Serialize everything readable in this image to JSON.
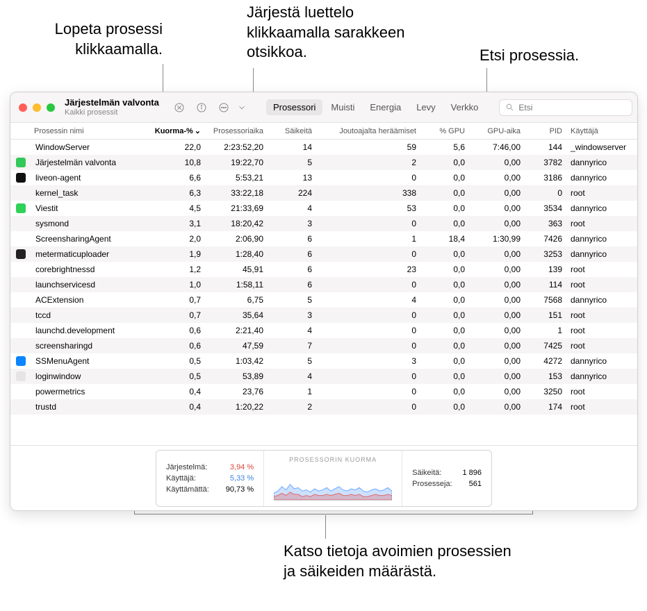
{
  "callouts": {
    "stop": "Lopeta prosessi klikkaamalla.",
    "sort": "Järjestä luettelo klikkaamalla sarakkeen otsikkoa.",
    "search": "Etsi prosessia.",
    "footer": "Katso tietoja avoimien prosessien ja säikeiden määrästä."
  },
  "window": {
    "title": "Järjestelmän valvonta",
    "subtitle": "Kaikki prosessit"
  },
  "tabs": {
    "cpu": "Prosessori",
    "memory": "Muisti",
    "energy": "Energia",
    "disk": "Levy",
    "network": "Verkko"
  },
  "search": {
    "placeholder": "Etsi"
  },
  "columns": {
    "name": "Prosessin nimi",
    "cpu": "Kuorma-%",
    "cputime": "Prosessoriaika",
    "threads": "Säikeitä",
    "idlewake": "Joutoajalta heräämiset",
    "gpu": "% GPU",
    "gputime": "GPU-aika",
    "pid": "PID",
    "user": "Käyttäjä"
  },
  "rows": [
    {
      "icon": "",
      "name": "WindowServer",
      "cpu": "22,0",
      "cputime": "2:23:52,20",
      "threads": "14",
      "idle": "59",
      "gpu": "5,6",
      "gputime": "7:46,00",
      "pid": "144",
      "user": "_windowserver"
    },
    {
      "icon": "#34c759",
      "name": "Järjestelmän valvonta",
      "cpu": "10,8",
      "cputime": "19:22,70",
      "threads": "5",
      "idle": "2",
      "gpu": "0,0",
      "gputime": "0,00",
      "pid": "3782",
      "user": "dannyrico"
    },
    {
      "icon": "#111",
      "name": "liveon-agent",
      "cpu": "6,6",
      "cputime": "5:53,21",
      "threads": "13",
      "idle": "0",
      "gpu": "0,0",
      "gputime": "0,00",
      "pid": "3186",
      "user": "dannyrico"
    },
    {
      "icon": "",
      "name": "kernel_task",
      "cpu": "6,3",
      "cputime": "33:22,18",
      "threads": "224",
      "idle": "338",
      "gpu": "0,0",
      "gputime": "0,00",
      "pid": "0",
      "user": "root"
    },
    {
      "icon": "#30d158",
      "name": "Viestit",
      "cpu": "4,5",
      "cputime": "21:33,69",
      "threads": "4",
      "idle": "53",
      "gpu": "0,0",
      "gputime": "0,00",
      "pid": "3534",
      "user": "dannyrico"
    },
    {
      "icon": "",
      "name": "sysmond",
      "cpu": "3,1",
      "cputime": "18:20,42",
      "threads": "3",
      "idle": "0",
      "gpu": "0,0",
      "gputime": "0,00",
      "pid": "363",
      "user": "root"
    },
    {
      "icon": "",
      "name": "ScreensharingAgent",
      "cpu": "2,0",
      "cputime": "2:06,90",
      "threads": "6",
      "idle": "1",
      "gpu": "18,4",
      "gputime": "1:30,99",
      "pid": "7426",
      "user": "dannyrico"
    },
    {
      "icon": "#222",
      "name": "metermaticuploader",
      "cpu": "1,9",
      "cputime": "1:28,40",
      "threads": "6",
      "idle": "0",
      "gpu": "0,0",
      "gputime": "0,00",
      "pid": "3253",
      "user": "dannyrico"
    },
    {
      "icon": "",
      "name": "corebrightnessd",
      "cpu": "1,2",
      "cputime": "45,91",
      "threads": "6",
      "idle": "23",
      "gpu": "0,0",
      "gputime": "0,00",
      "pid": "139",
      "user": "root"
    },
    {
      "icon": "",
      "name": "launchservicesd",
      "cpu": "1,0",
      "cputime": "1:58,11",
      "threads": "6",
      "idle": "0",
      "gpu": "0,0",
      "gputime": "0,00",
      "pid": "114",
      "user": "root"
    },
    {
      "icon": "",
      "name": "ACExtension",
      "cpu": "0,7",
      "cputime": "6,75",
      "threads": "5",
      "idle": "4",
      "gpu": "0,0",
      "gputime": "0,00",
      "pid": "7568",
      "user": "dannyrico"
    },
    {
      "icon": "",
      "name": "tccd",
      "cpu": "0,7",
      "cputime": "35,64",
      "threads": "3",
      "idle": "0",
      "gpu": "0,0",
      "gputime": "0,00",
      "pid": "151",
      "user": "root"
    },
    {
      "icon": "",
      "name": "launchd.development",
      "cpu": "0,6",
      "cputime": "2:21,40",
      "threads": "4",
      "idle": "0",
      "gpu": "0,0",
      "gputime": "0,00",
      "pid": "1",
      "user": "root"
    },
    {
      "icon": "",
      "name": "screensharingd",
      "cpu": "0,6",
      "cputime": "47,59",
      "threads": "7",
      "idle": "0",
      "gpu": "0,0",
      "gputime": "0,00",
      "pid": "7425",
      "user": "root"
    },
    {
      "icon": "#0a84ff",
      "name": "SSMenuAgent",
      "cpu": "0,5",
      "cputime": "1:03,42",
      "threads": "5",
      "idle": "3",
      "gpu": "0,0",
      "gputime": "0,00",
      "pid": "4272",
      "user": "dannyrico"
    },
    {
      "icon": "#e5e5e5",
      "name": "loginwindow",
      "cpu": "0,5",
      "cputime": "53,89",
      "threads": "4",
      "idle": "0",
      "gpu": "0,0",
      "gputime": "0,00",
      "pid": "153",
      "user": "dannyrico"
    },
    {
      "icon": "",
      "name": "powermetrics",
      "cpu": "0,4",
      "cputime": "23,76",
      "threads": "1",
      "idle": "0",
      "gpu": "0,0",
      "gputime": "0,00",
      "pid": "3250",
      "user": "root"
    },
    {
      "icon": "",
      "name": "trustd",
      "cpu": "0,4",
      "cputime": "1:20,22",
      "threads": "2",
      "idle": "0",
      "gpu": "0,0",
      "gputime": "0,00",
      "pid": "174",
      "user": "root"
    }
  ],
  "footer": {
    "system_label": "Järjestelmä:",
    "system_val": "3,94 %",
    "user_label": "Käyttäjä:",
    "user_val": "5,33 %",
    "idle_label": "Käyttämättä:",
    "idle_val": "90,73 %",
    "chart_title": "PROSESSORIN KUORMA",
    "threads_label": "Säikeitä:",
    "threads_val": "1 896",
    "procs_label": "Prosesseja:",
    "procs_val": "561"
  },
  "chart_data": {
    "type": "area",
    "title": "PROSESSORIN KUORMA",
    "ylim": [
      0,
      30
    ],
    "series": [
      {
        "name": "Käyttäjä",
        "color": "#6fa8ff",
        "values": [
          6,
          8,
          12,
          9,
          14,
          10,
          11,
          8,
          9,
          7,
          10,
          8,
          9,
          11,
          8,
          10,
          12,
          9,
          8,
          10,
          9,
          11,
          8,
          7,
          9,
          10,
          8,
          9,
          11,
          8
        ]
      },
      {
        "name": "Järjestelmä",
        "color": "#e06a6a",
        "values": [
          3,
          4,
          6,
          4,
          7,
          5,
          5,
          3,
          4,
          3,
          5,
          4,
          4,
          5,
          4,
          5,
          6,
          4,
          4,
          5,
          4,
          5,
          3,
          3,
          4,
          5,
          4,
          4,
          5,
          4
        ]
      }
    ]
  }
}
